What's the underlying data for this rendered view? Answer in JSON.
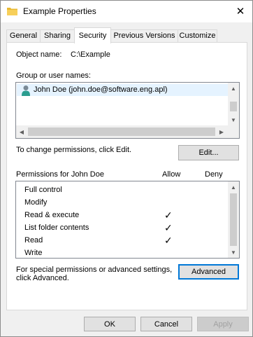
{
  "window": {
    "title": "Example Properties",
    "close_glyph": "✕",
    "folder_icon": "folder-icon"
  },
  "tabs": [
    {
      "label": "General"
    },
    {
      "label": "Sharing"
    },
    {
      "label": "Security",
      "active": true
    },
    {
      "label": "Previous Versions"
    },
    {
      "label": "Customize"
    }
  ],
  "security": {
    "object_name_label": "Object name:",
    "object_name_value": "C:\\Example",
    "group_label": "Group or user names:",
    "users": [
      {
        "name": "John Doe (john.doe@software.eng.apl)",
        "icon": "user-icon"
      }
    ],
    "change_hint": "To change permissions, click Edit.",
    "edit_button": "Edit...",
    "permissions_label": "Permissions for John Doe",
    "allow_header": "Allow",
    "deny_header": "Deny",
    "permissions": [
      {
        "name": "Full control",
        "allow": false,
        "deny": false
      },
      {
        "name": "Modify",
        "allow": false,
        "deny": false
      },
      {
        "name": "Read & execute",
        "allow": true,
        "deny": false
      },
      {
        "name": "List folder contents",
        "allow": true,
        "deny": false
      },
      {
        "name": "Read",
        "allow": true,
        "deny": false
      },
      {
        "name": "Write",
        "allow": false,
        "deny": false
      }
    ],
    "check_glyph": "✓",
    "advanced_hint_line1": "For special permissions or advanced settings,",
    "advanced_hint_line2": "click Advanced.",
    "advanced_button": "Advanced"
  },
  "footer": {
    "ok": "OK",
    "cancel": "Cancel",
    "apply": "Apply",
    "apply_enabled": false
  },
  "colors": {
    "selection": "#e5f3ff",
    "accent": "#0078d7",
    "folder": "#e8b830"
  }
}
